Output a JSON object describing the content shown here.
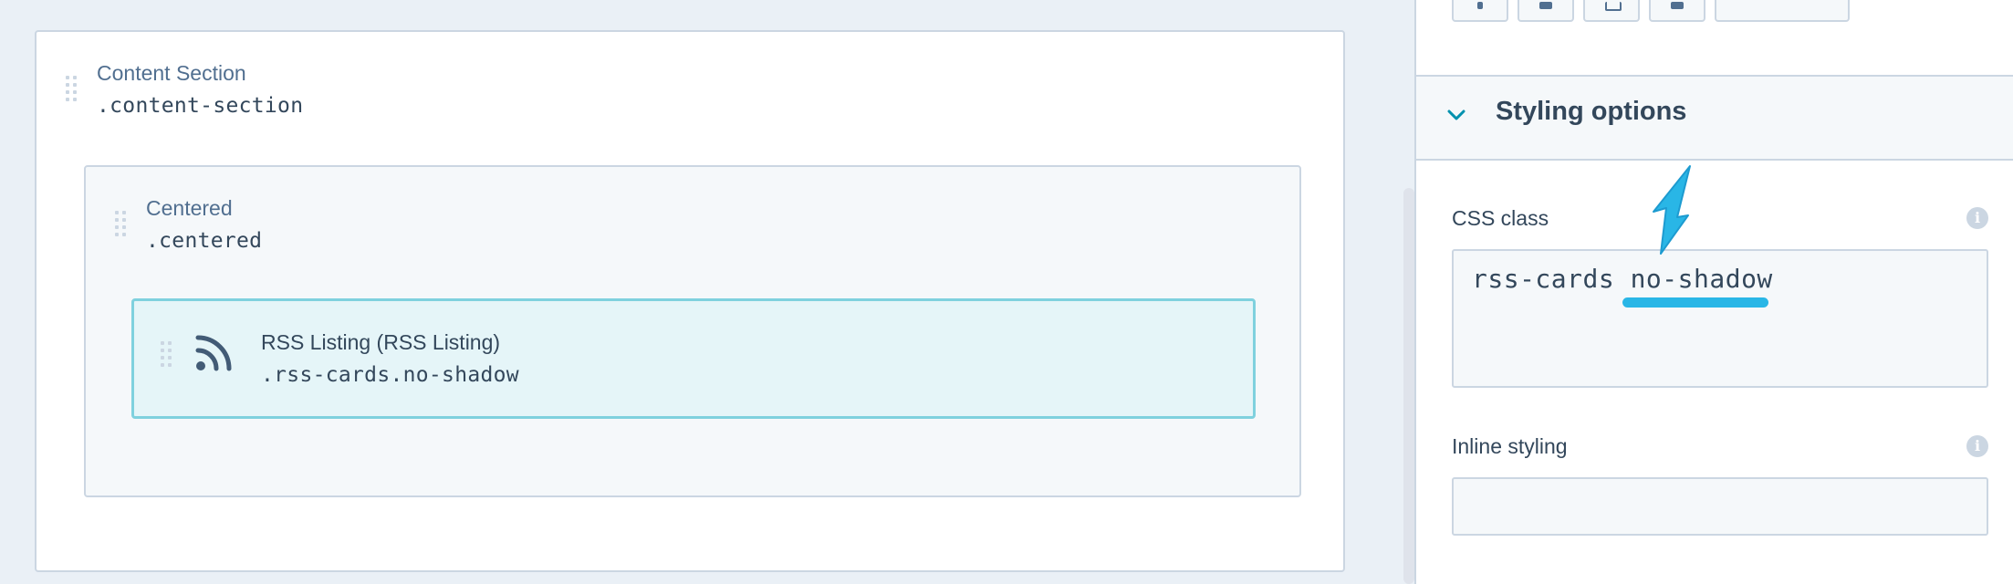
{
  "canvas": {
    "content_section": {
      "label": "Content Section",
      "class_name": ".content-section"
    },
    "centered": {
      "label": "Centered",
      "class_name": ".centered"
    },
    "rss_module": {
      "label": "RSS Listing (RSS Listing)",
      "class_name": ".rss-cards.no-shadow",
      "icon": "rss-icon"
    }
  },
  "panel": {
    "styling_options": {
      "title": "Styling options",
      "expanded": true
    },
    "css_class": {
      "label": "CSS class",
      "value": "rss-cards no-shadow"
    },
    "inline_styling": {
      "label": "Inline styling",
      "value": ""
    }
  },
  "colors": {
    "accent": "#7fd1de",
    "highlight": "#29b6e6",
    "text": "#33475b",
    "border": "#cbd6e2"
  }
}
